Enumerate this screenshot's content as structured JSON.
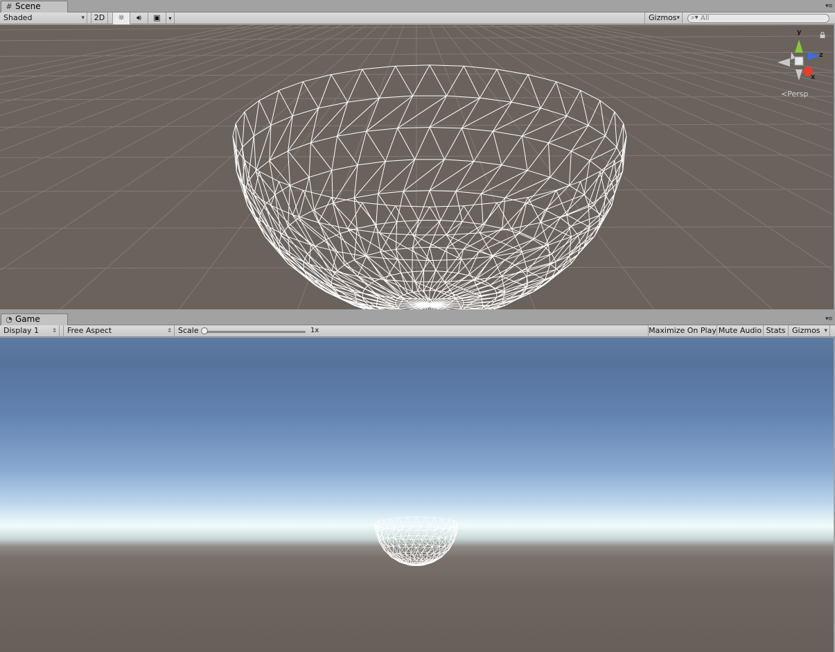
{
  "scene": {
    "tab_label": "Scene",
    "tab_icon": "grid-icon",
    "toolbar": {
      "draw_mode": "Shaded",
      "mode_2d": "2D",
      "lighting_icon": "sun-icon",
      "audio_icon": "speaker-icon",
      "effects_icon": "image-icon",
      "gizmos_label": "Gizmos",
      "search_placeholder": "All"
    },
    "orientation_gizmo": {
      "y_label": "y",
      "z_label": "z",
      "x_label": "x",
      "projection": "Persp",
      "colors": {
        "y": "#8cc63e",
        "z": "#3c6fd8",
        "x": "#e0402c",
        "neutral": "#c8c8c8"
      }
    }
  },
  "game": {
    "tab_label": "Game",
    "tab_icon": "pacman-icon",
    "toolbar": {
      "display": "Display 1",
      "aspect": "Free Aspect",
      "scale_label": "Scale",
      "scale_value": "1x",
      "scale_fraction": 0,
      "maximize_on_play": "Maximize On Play",
      "mute_audio": "Mute Audio",
      "stats": "Stats",
      "gizmos_label": "Gizmos"
    }
  },
  "colors": {
    "scene_background": "#6a625c",
    "wireframe": "#ffffff",
    "grid_line": "#8a8480"
  }
}
